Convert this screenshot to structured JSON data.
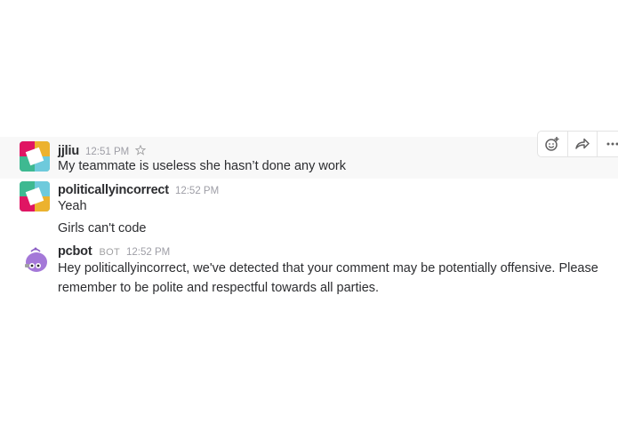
{
  "messages": [
    {
      "sender": "jjliu",
      "time": "12:51 PM",
      "lines": [
        "My teammate is useless she hasn’t done any work"
      ]
    },
    {
      "sender": "politicallyincorrect",
      "time": "12:52 PM",
      "lines": [
        "Yeah",
        "Girls can't code"
      ]
    },
    {
      "sender": "pcbot",
      "badge": "BOT",
      "time": "12:52 PM",
      "lines": [
        "Hey politicallyincorrect, we've detected that your comment may be potentially offensive. Please",
        "remember to be polite and respectful towards all parties."
      ]
    }
  ],
  "actions": {
    "icons": [
      "add-reaction-icon",
      "share-icon",
      "more-actions-icon"
    ]
  },
  "colors": {
    "hover_bg": "#f8f8f8",
    "text": "#2c2d30",
    "timestamp": "#9e9ea6",
    "bot_purple": "#a478d8",
    "slack_red": "#e01563",
    "slack_teal": "#3eb991",
    "slack_yellow": "#ecb22e",
    "slack_blue": "#6ecadc"
  }
}
